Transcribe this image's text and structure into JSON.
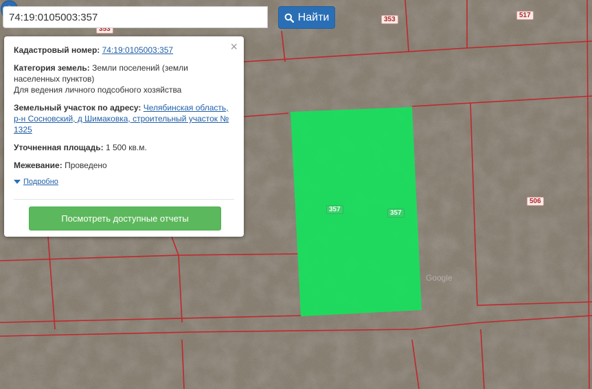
{
  "search": {
    "value": "74:19:0105003:357",
    "button_label": "Найти"
  },
  "popup": {
    "cadastral_label": "Кадастровый номер:",
    "cadastral_value": "74:19:0105003:357",
    "category_label": "Категория земель:",
    "category_value": "Земли поселений (земли населенных пунктов)",
    "usage_value": "Для ведения личного подсобного хозяйства",
    "address_label": "Земельный участок по адресу:",
    "address_value": "Челябинская область, р-н Сосновский, д Шимаковка, строительный участок № 1325",
    "area_label": "Уточненная площадь:",
    "area_value": "1 500 кв.м.",
    "survey_label": "Межевание:",
    "survey_value": "Проведено",
    "details_label": "Подробно",
    "report_button": "Посмотреть доступные отчеты",
    "close_glyph": "×"
  },
  "map": {
    "labels": [
      "357",
      "357",
      "353",
      "517",
      "506",
      "353"
    ],
    "watermark": "Google"
  },
  "colors": {
    "primary": "#2a6fb6",
    "success": "#5cb85c",
    "parcel_fill": "#17e05d",
    "boundary": "#c0272d"
  }
}
